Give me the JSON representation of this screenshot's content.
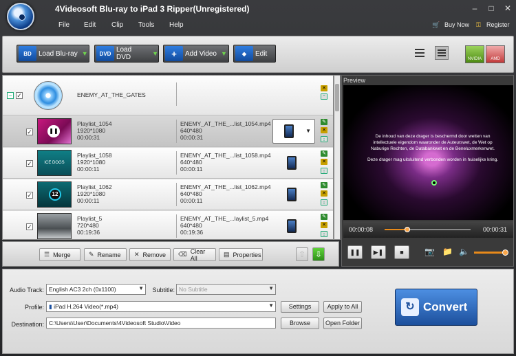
{
  "window": {
    "title": "4Videosoft Blu-ray to iPad 3 Ripper(Unregistered)"
  },
  "menu": [
    "File",
    "Edit",
    "Clip",
    "Tools",
    "Help"
  ],
  "right_menu": {
    "buy": "Buy Now",
    "register": "Register"
  },
  "toolbar": {
    "load_bluray": "Load Blu-ray",
    "load_dvd": "Load DVD",
    "add_video": "Add Video",
    "edit": "Edit",
    "nvidia": "NVIDIA",
    "amd": "AMD"
  },
  "disc": {
    "title": "ENEMY_AT_THE_GATES"
  },
  "rows": [
    {
      "name": "Playlist_1054",
      "res": "1920*1080",
      "dur": "00:00:31",
      "out_name": "ENEMY_AT_THE_...list_1054.mp4",
      "out_res": "640*480",
      "out_dur": "00:00:31"
    },
    {
      "name": "Playlist_1058",
      "res": "1920*1080",
      "dur": "00:00:11",
      "out_name": "ENEMY_AT_THE_...list_1058.mp4",
      "out_res": "640*480",
      "out_dur": "00:00:11"
    },
    {
      "name": "Playlist_1062",
      "res": "1920*1080",
      "dur": "00:00:11",
      "out_name": "ENEMY_AT_THE_...list_1062.mp4",
      "out_res": "640*480",
      "out_dur": "00:00:11"
    },
    {
      "name": "Playlist_5",
      "res": "720*480",
      "dur": "00:19:36",
      "out_name": "ENEMY_AT_THE_...laylist_5.mp4",
      "out_res": "640*480",
      "out_dur": "00:19:36"
    }
  ],
  "thumb_labels": {
    "r2": "ICE DOGS",
    "r3": "12"
  },
  "actions": {
    "merge": "Merge",
    "rename": "Rename",
    "remove": "Remove",
    "clear_all": "Clear All",
    "properties": "Properties"
  },
  "preview": {
    "label": "Preview",
    "text1": "De inhoud van deze drager is beschermd door wetten van intellectuele eigendom waaronder de Auteurswet, de Wet op Naburige Rechten, de Databankwet en de Beneluxmerkenwet.",
    "text2": "Deze drager mag uitsluitend verbonden worden in huiselijke kring.",
    "current_time": "00:00:08",
    "total_time": "00:00:31",
    "progress": 0.26,
    "volume": 0.9
  },
  "settings": {
    "audio_label": "Audio Track:",
    "audio_value": "English AC3 2ch (0x1100)",
    "subtitle_label": "Subtitle:",
    "subtitle_value": "No Subtitle",
    "profile_label": "Profile:",
    "profile_value": "iPad H.264 Video(*.mp4)",
    "settings_btn": "Settings",
    "apply_all": "Apply to All",
    "dest_label": "Destination:",
    "dest_value": "C:\\Users\\User\\Documents\\4Videosoft Studio\\Video",
    "browse": "Browse",
    "open_folder": "Open Folder",
    "convert": "Convert"
  }
}
